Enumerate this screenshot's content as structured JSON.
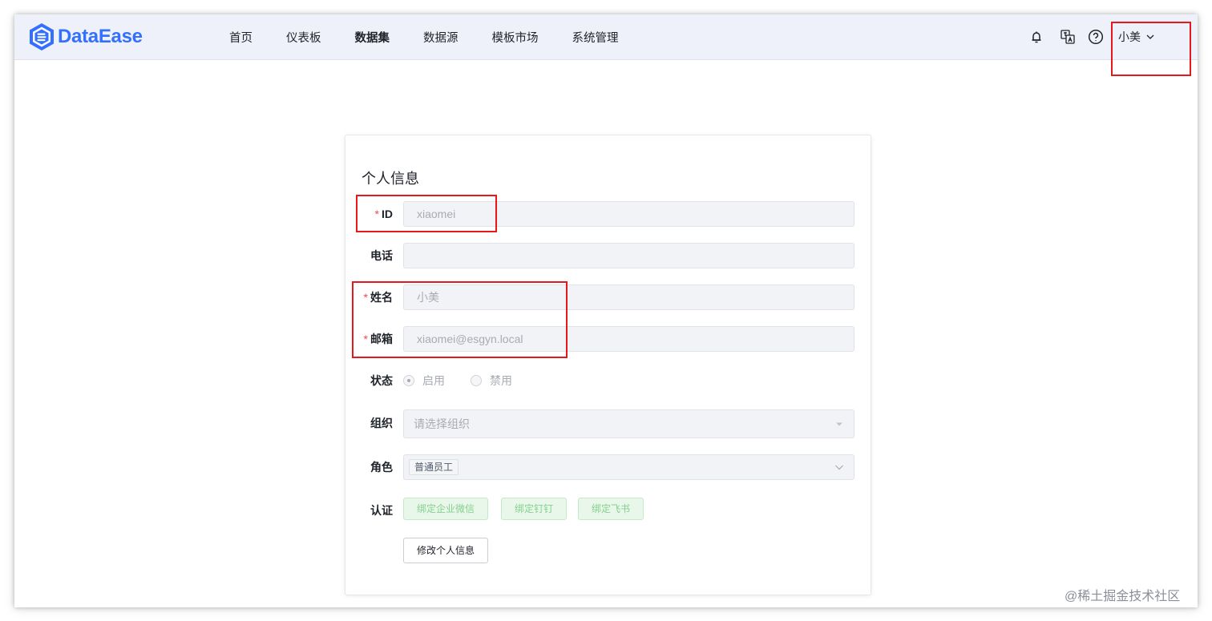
{
  "app": {
    "name": "DataEase",
    "brand_color": "#3370ff"
  },
  "nav": {
    "items": [
      {
        "label": "首页",
        "active": false
      },
      {
        "label": "仪表板",
        "active": false
      },
      {
        "label": "数据集",
        "active": true
      },
      {
        "label": "数据源",
        "active": false
      },
      {
        "label": "模板市场",
        "active": false
      },
      {
        "label": "系统管理",
        "active": false
      }
    ]
  },
  "header": {
    "icons": [
      "bell-icon",
      "translate-icon",
      "help-icon"
    ],
    "user_name": "小美"
  },
  "profile": {
    "title": "个人信息",
    "fields": {
      "id": {
        "label": "ID",
        "required": true,
        "value": "xiaomei"
      },
      "phone": {
        "label": "电话",
        "required": false,
        "value": ""
      },
      "name": {
        "label": "姓名",
        "required": true,
        "value": "小美"
      },
      "email": {
        "label": "邮箱",
        "required": true,
        "value": "xiaomei@esgyn.local"
      }
    },
    "status": {
      "label": "状态",
      "options": [
        {
          "label": "启用",
          "checked": true
        },
        {
          "label": "禁用",
          "checked": false
        }
      ]
    },
    "org": {
      "label": "组织",
      "placeholder": "请选择组织"
    },
    "role": {
      "label": "角色",
      "tags": [
        "普通员工"
      ]
    },
    "auth": {
      "label": "认证",
      "buttons": [
        "绑定企业微信",
        "绑定钉钉",
        "绑定飞书"
      ]
    },
    "edit_button": "修改个人信息"
  },
  "colors": {
    "highlight_box": "#e5191a",
    "required_star": "#f54a45",
    "auth_button_text": "#86d08f"
  },
  "watermark": "@稀土掘金技术社区"
}
